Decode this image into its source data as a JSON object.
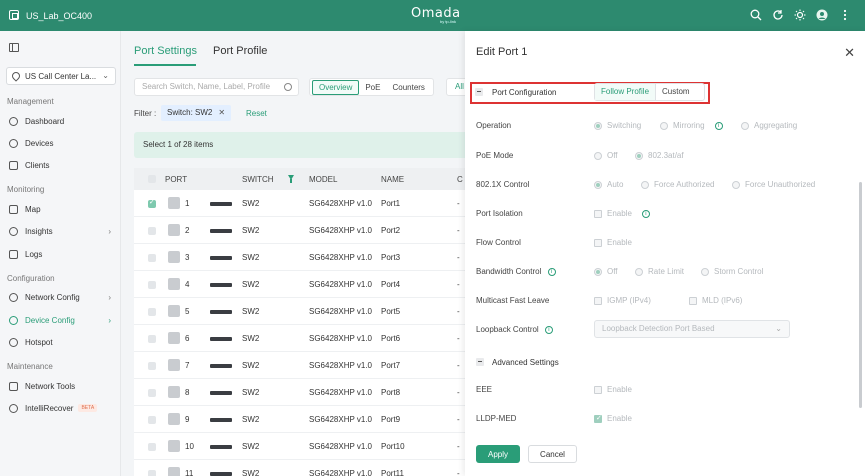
{
  "header": {
    "site_name": "US_Lab_OC400",
    "brand": "Omada",
    "brand_sub": "by tp-link"
  },
  "sidebar": {
    "site_select": "US Call Center La...",
    "sections": {
      "management": "Management",
      "monitoring": "Monitoring",
      "configuration": "Configuration",
      "maintenance": "Maintenance"
    },
    "items": [
      {
        "label": "Dashboard"
      },
      {
        "label": "Devices"
      },
      {
        "label": "Clients"
      },
      {
        "label": "Map"
      },
      {
        "label": "Insights"
      },
      {
        "label": "Logs"
      },
      {
        "label": "Network Config"
      },
      {
        "label": "Device Config"
      },
      {
        "label": "Hotspot"
      },
      {
        "label": "Network Tools"
      },
      {
        "label": "IntelliRecover"
      }
    ],
    "beta": "BETA"
  },
  "main": {
    "tabs": [
      "Port Settings",
      "Port Profile"
    ],
    "search_placeholder": "Search Switch, Name, Label, Profile",
    "views": [
      "Overview",
      "PoE",
      "Counters"
    ],
    "view_all": "All",
    "filter_label": "Filter :",
    "filter_chip": "Switch: SW2",
    "reset": "Reset",
    "selection": "Select 1 of 28 items",
    "columns": [
      "PORT",
      "SWITCH",
      "MODEL",
      "NAME",
      "C"
    ],
    "rows": [
      {
        "port": "1",
        "switch": "SW2",
        "model": "SG6428XHP v1.0",
        "name": "Port1",
        "extra": "-"
      },
      {
        "port": "2",
        "switch": "SW2",
        "model": "SG6428XHP v1.0",
        "name": "Port2",
        "extra": "-"
      },
      {
        "port": "3",
        "switch": "SW2",
        "model": "SG6428XHP v1.0",
        "name": "Port3",
        "extra": "-"
      },
      {
        "port": "4",
        "switch": "SW2",
        "model": "SG6428XHP v1.0",
        "name": "Port4",
        "extra": "-"
      },
      {
        "port": "5",
        "switch": "SW2",
        "model": "SG6428XHP v1.0",
        "name": "Port5",
        "extra": "-"
      },
      {
        "port": "6",
        "switch": "SW2",
        "model": "SG6428XHP v1.0",
        "name": "Port6",
        "extra": "-"
      },
      {
        "port": "7",
        "switch": "SW2",
        "model": "SG6428XHP v1.0",
        "name": "Port7",
        "extra": "-"
      },
      {
        "port": "8",
        "switch": "SW2",
        "model": "SG6428XHP v1.0",
        "name": "Port8",
        "extra": "-"
      },
      {
        "port": "9",
        "switch": "SW2",
        "model": "SG6428XHP v1.0",
        "name": "Port9",
        "extra": "-"
      },
      {
        "port": "10",
        "switch": "SW2",
        "model": "SG6428XHP v1.0",
        "name": "Port10",
        "extra": "-"
      },
      {
        "port": "11",
        "switch": "SW2",
        "model": "SG6428XHP v1.0",
        "name": "Port11",
        "extra": "-"
      }
    ]
  },
  "panel": {
    "title": "Edit Port 1",
    "port_config": "Port Configuration",
    "follow_profile": "Follow Profile",
    "custom": "Custom",
    "fields": {
      "operation": {
        "label": "Operation",
        "options": [
          "Switching",
          "Mirroring",
          "Aggregating"
        ]
      },
      "poe_mode": {
        "label": "PoE Mode",
        "options": [
          "Off",
          "802.3at/af"
        ]
      },
      "dot1x": {
        "label": "802.1X Control",
        "options": [
          "Auto",
          "Force Authorized",
          "Force Unauthorized"
        ]
      },
      "isolation": {
        "label": "Port Isolation",
        "option": "Enable"
      },
      "flow": {
        "label": "Flow Control",
        "option": "Enable"
      },
      "bandwidth": {
        "label": "Bandwidth Control",
        "options": [
          "Off",
          "Rate Limit",
          "Storm Control"
        ]
      },
      "multicast": {
        "label": "Multicast Fast Leave",
        "options": [
          "IGMP (IPv4)",
          "MLD (IPv6)"
        ]
      },
      "loopback": {
        "label": "Loopback Control",
        "value": "Loopback Detection Port Based"
      }
    },
    "advanced": "Advanced Settings",
    "eee": {
      "label": "EEE",
      "option": "Enable"
    },
    "lldp": {
      "label": "LLDP-MED",
      "option": "Enable"
    },
    "apply": "Apply",
    "cancel": "Cancel"
  }
}
